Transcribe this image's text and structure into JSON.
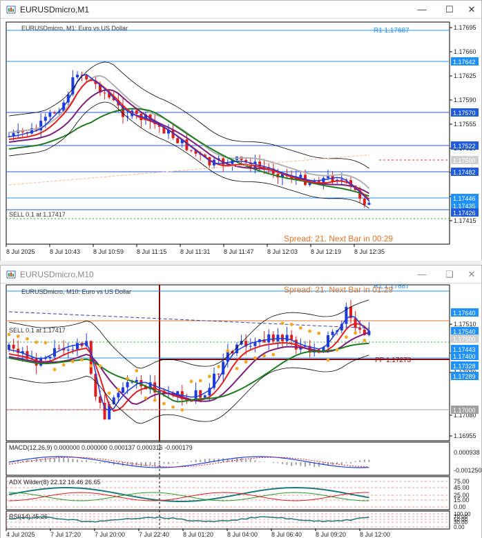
{
  "window1": {
    "title": "EURUSDmicro,M1",
    "chart_label": "EURUSDmicro, M1:  Euro vs US Dollar",
    "r1_label": "R1 1.17687",
    "sell_label": "SELL 0.1 at 1.17417",
    "spread_text": "Spread: 21. Next Bar in 00:29",
    "price_ticks": [
      "1.17695",
      "1.17660",
      "1.17625",
      "1.17590",
      "1.17555",
      "1.17520",
      "1.17485",
      "1.17450",
      "1.17415"
    ],
    "highlight_prices": [
      {
        "text": "1.17642",
        "color": "#1e90ff"
      },
      {
        "text": "1.17570",
        "color": "#1e5adc"
      },
      {
        "text": "1.17522",
        "color": "#1e5adc"
      },
      {
        "text": "1.17500",
        "color": "#d0d0d0"
      },
      {
        "text": "1.17482",
        "color": "#1e5adc"
      },
      {
        "text": "1.17446",
        "color": "#1e90ff"
      },
      {
        "text": "1.17435",
        "color": "#1e90ff"
      },
      {
        "text": "1.17426",
        "color": "#1e5adc"
      }
    ],
    "time_ticks": [
      "8 Jul 2025",
      "8 Jul 10:43",
      "8 Jul 10:59",
      "8 Jul 11:15",
      "8 Jul 11:31",
      "8 Jul 11:47",
      "8 Jul 12:03",
      "8 Jul 12:19",
      "8 Jul 12:35"
    ]
  },
  "window2": {
    "title": "EURUSDmicro,M10",
    "chart_label": "EURUSDmicro, M10:  Euro vs US Dollar",
    "r1_label": "R1 1.17687",
    "pp_label": "PP 1.17273",
    "sell_label": "SELL 0.1 at 1.17417",
    "spread_text": "Spread: 21. Next Bar in 01:29",
    "price_ticks": [
      "1.17510",
      "1.17390",
      "1.17270",
      "1.17080",
      "1.16955"
    ],
    "highlight_prices": [
      {
        "text": "1.17640",
        "color": "#1e90ff"
      },
      {
        "text": "1.17540",
        "color": "#1e90ff"
      },
      {
        "text": "1.17500",
        "color": "#d0d0d0"
      },
      {
        "text": "1.17443",
        "color": "#1e90ff"
      },
      {
        "text": "1.17400",
        "color": "#1e90ff"
      },
      {
        "text": "1.17328",
        "color": "#1e90ff"
      },
      {
        "text": "1.17289",
        "color": "#1e90ff"
      },
      {
        "text": "1.17000",
        "color": "#a0a0a0"
      }
    ],
    "macd_label": "MACD(12,26,9) 0.000000 0.000000 0.000137 0.000316 -0.000179",
    "macd_ticks": [
      "0.000938",
      "-0.001250"
    ],
    "adx_label": "ADX Wilder(8) 22.12 16.46 26.65",
    "adx_ticks": [
      "75.00",
      "45.00",
      "25.00",
      "15.00",
      "0.00"
    ],
    "rsi_label": "RSI(14) 45.26",
    "rsi_ticks": [
      "100.00",
      "70.00",
      "50.00",
      "30.00",
      "0.00"
    ],
    "time_ticks": [
      "4 Jul 2025",
      "7 Jul 17:20",
      "7 Jul 20:00",
      "7 Jul 22:40",
      "8 Jul 01:20",
      "8 Jul 04:00",
      "8 Jul 06:40",
      "8 Jul 09:20",
      "8 Jul 12:00"
    ]
  },
  "colors": {
    "bull": "#1e3cdc",
    "bear": "#dc1e1e",
    "ma_red": "#e02020",
    "ma_purple": "#7a1e7a",
    "ma_green": "#1e7a1e",
    "ma_gray": "#b0b0b0",
    "sar": "#f5a623"
  },
  "icons": [
    "app-icon",
    "minimize-icon",
    "maximize-icon",
    "close-icon",
    "restore-icon"
  ]
}
